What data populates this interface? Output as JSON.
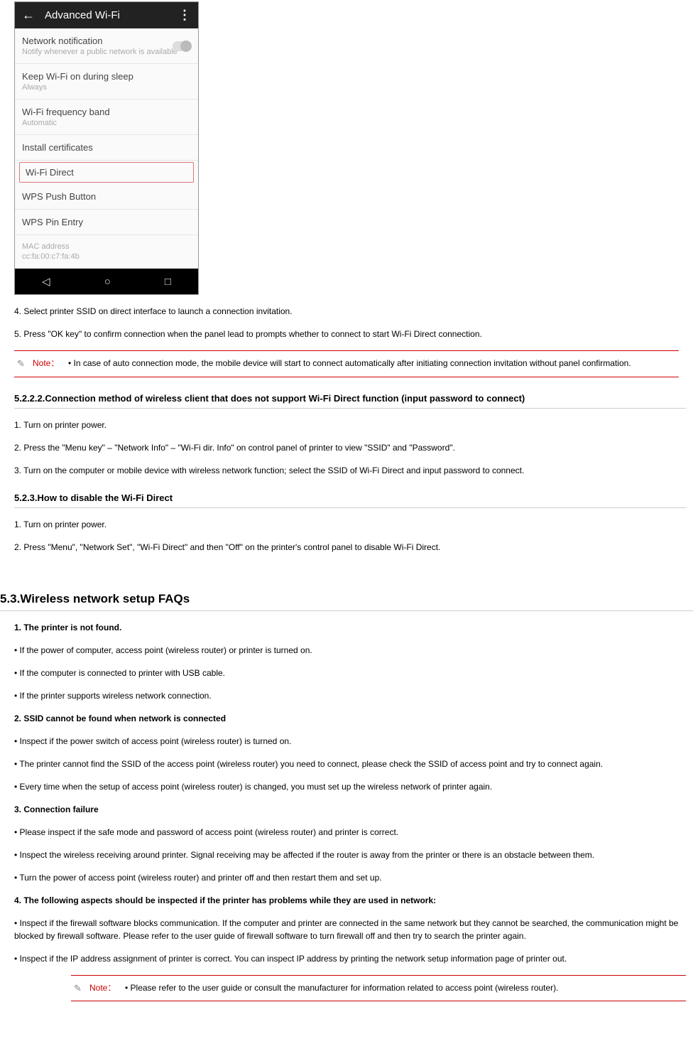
{
  "phone": {
    "topTitle": "Advanced Wi-Fi",
    "items": [
      {
        "label": "Network notification",
        "sub": "Notify whenever a public network is available",
        "hasToggle": true
      },
      {
        "label": "Keep Wi-Fi on during sleep",
        "sub": "Always"
      },
      {
        "label": "Wi-Fi frequency band",
        "sub": "Automatic"
      },
      {
        "label": "Install certificates"
      },
      {
        "label": "Wi-Fi Direct",
        "highlight": true
      },
      {
        "label": "WPS Push Button"
      },
      {
        "label": "WPS Pin Entry"
      }
    ],
    "mac": {
      "label": "MAC address",
      "sub": "cc:fa:00:c7:fa:4b"
    }
  },
  "steps_a": [
    "4. Select printer SSID on direct interface to launch a connection invitation.",
    "5. Press \"OK key\" to confirm connection when the panel lead to prompts whether to connect to start Wi-Fi Direct connection."
  ],
  "note1": {
    "label": "Note：",
    "text": "• In case of auto connection mode, the mobile device will start to connect automatically after initiating connection invitation without panel confirmation."
  },
  "h_5222": "5.2.2.2.Connection method of wireless client that does not support Wi-Fi Direct function (input password to connect)",
  "steps_b": [
    "1. Turn on printer power.",
    "2. Press the \"Menu key\" – \"Network Info\" – \"Wi-Fi dir. Info\" on control panel of printer to view \"SSID\" and \"Password\".",
    "3. Turn on the computer or mobile device with wireless network function; select the SSID of Wi-Fi Direct and input password to connect."
  ],
  "h_523": "5.2.3.How to disable the Wi-Fi Direct",
  "steps_c": [
    "1. Turn on printer power.",
    "2. Press \"Menu\", \"Network Set\", \"Wi-Fi Direct\" and then \"Off\" on the printer's control panel to disable Wi-Fi Direct."
  ],
  "h_53": "5.3.Wireless network setup FAQs",
  "faq": [
    {
      "bold": true,
      "text": "1. The printer is not found."
    },
    {
      "bold": false,
      "text": "• If the power of computer, access point (wireless router) or printer is turned on."
    },
    {
      "bold": false,
      "text": "• If the computer is connected to printer with USB cable."
    },
    {
      "bold": false,
      "text": "• If the printer supports wireless network connection."
    },
    {
      "bold": true,
      "text": "2. SSID cannot be found when network is connected"
    },
    {
      "bold": false,
      "text": "• Inspect if the power switch of access point (wireless router) is turned on."
    },
    {
      "bold": false,
      "text": "• The printer cannot find the SSID of the access point (wireless router) you need to connect, please check the SSID of access point and try to connect again."
    },
    {
      "bold": false,
      "text": "• Every time when the setup of access point (wireless router) is changed, you must set up the wireless network of printer again."
    },
    {
      "bold": true,
      "text": "3. Connection failure"
    },
    {
      "bold": false,
      "text": "• Please inspect if the safe mode and password of access point (wireless router) and printer is correct."
    },
    {
      "bold": false,
      "text": "• Inspect the wireless receiving around printer. Signal receiving may be affected if the router is away from the printer or there is an obstacle between them."
    },
    {
      "bold": false,
      "text": "• Turn the power of access point (wireless router) and printer off and then restart them and set up."
    },
    {
      "bold": true,
      "text": "4. The following aspects should be inspected if the printer has problems while they are used in network:"
    },
    {
      "bold": false,
      "text": "• Inspect if the firewall software blocks communication. If the computer and printer are connected in the same network but they cannot be searched, the communication might be blocked by firewall software. Please refer to the user guide of firewall software to turn firewall off and then try to search the printer again."
    },
    {
      "bold": false,
      "text": "• Inspect if the IP address assignment of printer is correct. You can inspect IP address by printing the network setup information page of printer out."
    }
  ],
  "note2": {
    "label": "Note：",
    "text": "• Please refer to the user guide or consult the manufacturer for information related to access point (wireless router)."
  }
}
